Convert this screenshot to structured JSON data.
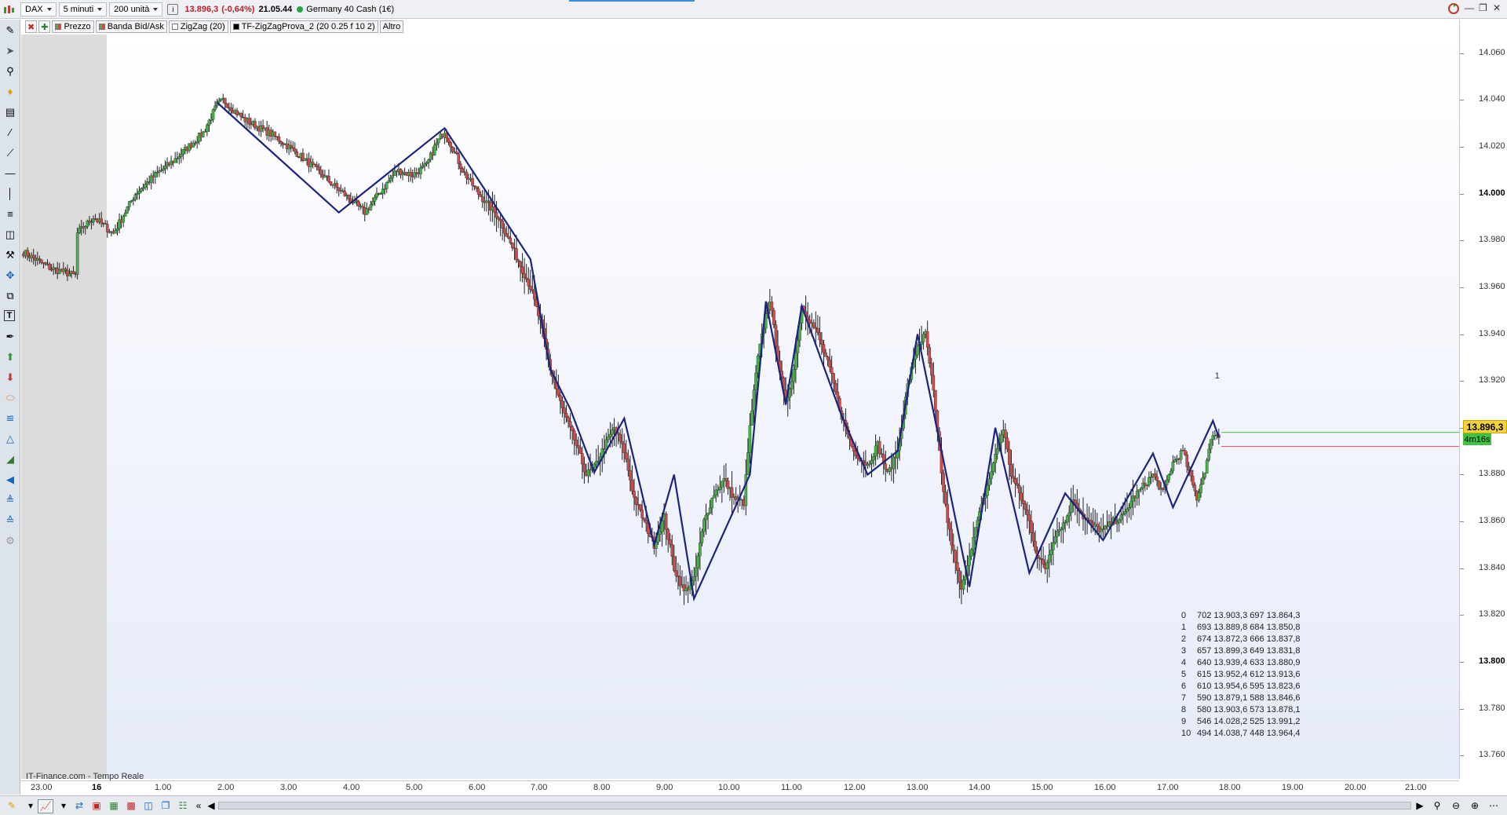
{
  "toolbar": {
    "symbol": "DAX",
    "timeframe": "5 minuti",
    "units": "200 unità",
    "info_icon": "info-icon",
    "last_price": "13.896,3",
    "change": "(-0,64%)",
    "time": "21.05.44",
    "instrument": "Germany 40 Cash (1€)"
  },
  "indicators": {
    "price": "Prezzo",
    "bidask": "Banda Bid/Ask",
    "zigzag": "ZigZag (20)",
    "tfzigzag": "TF-ZigZagProva_2 (20 0.25 f 10 2)",
    "more": "Altro"
  },
  "footer_note": "IT-Finance.com - Tempo Reale",
  "current_price_tag": "13.896,3",
  "timer_tag": "4m16s",
  "zz_marker": "1",
  "zigzag_table": [
    [
      "0",
      "702 13.903,3 697 13.864,3"
    ],
    [
      "1",
      "693 13.889,8 684 13.850,8"
    ],
    [
      "2",
      "674 13.872,3 666 13.837,8"
    ],
    [
      "3",
      "657 13.899,3 649 13.831,8"
    ],
    [
      "4",
      "640 13.939,4 633 13.880,9"
    ],
    [
      "5",
      "615 13.952,4 612 13.913,6"
    ],
    [
      "6",
      "610 13.954,6 595 13.823,6"
    ],
    [
      "7",
      "590 13.879,1 588 13.846,6"
    ],
    [
      "8",
      "580 13.903,6 573 13.878,1"
    ],
    [
      "9",
      "546 14.028,2 525 13.991,2"
    ],
    [
      "10",
      "494 14.038,7 448 13.964,4"
    ]
  ],
  "colors": {
    "bull": "#45b245",
    "bear": "#d24a4a",
    "zigzag": "#1a237e",
    "accent": "#3a8ee6"
  },
  "chart_data": {
    "type": "candlestick",
    "xlabels": [
      "23.00",
      "16",
      "1.00",
      "2.00",
      "3.00",
      "4.00",
      "5.00",
      "6.00",
      "7.00",
      "8.00",
      "9.00",
      "10.00",
      "11.00",
      "12.00",
      "13.00",
      "14.00",
      "15.00",
      "16.00",
      "17.00",
      "18.00",
      "19.00",
      "20.00",
      "21.00"
    ],
    "ylabels": [
      "14.060",
      "14.040",
      "14.020",
      "14.000",
      "13.980",
      "13.960",
      "13.940",
      "13.920",
      "13.900",
      "13.880",
      "13.860",
      "13.840",
      "13.820",
      "13.800",
      "13.780",
      "13.760"
    ],
    "ylim": [
      13750,
      14068
    ],
    "anchors": [
      [
        0,
        13975
      ],
      [
        14,
        13968
      ],
      [
        26,
        13965
      ],
      [
        27,
        13983
      ],
      [
        35,
        13990
      ],
      [
        45,
        13983
      ],
      [
        56,
        14000
      ],
      [
        66,
        14008
      ],
      [
        75,
        14014
      ],
      [
        85,
        14022
      ],
      [
        90,
        14026
      ],
      [
        97,
        14038
      ],
      [
        100,
        14040
      ],
      [
        110,
        14032
      ],
      [
        125,
        14025
      ],
      [
        139,
        14016
      ],
      [
        151,
        14007
      ],
      [
        163,
        13998
      ],
      [
        171,
        13992
      ],
      [
        179,
        14001
      ],
      [
        187,
        14010
      ],
      [
        195,
        14008
      ],
      [
        202,
        14012
      ],
      [
        206,
        14020
      ],
      [
        211,
        14027
      ],
      [
        220,
        14010
      ],
      [
        228,
        14000
      ],
      [
        238,
        13990
      ],
      [
        246,
        13975
      ],
      [
        254,
        13960
      ],
      [
        259,
        13945
      ],
      [
        264,
        13925
      ],
      [
        270,
        13908
      ],
      [
        276,
        13895
      ],
      [
        282,
        13880
      ],
      [
        286,
        13883
      ],
      [
        291,
        13892
      ],
      [
        296,
        13900
      ],
      [
        301,
        13890
      ],
      [
        306,
        13870
      ],
      [
        311,
        13860
      ],
      [
        316,
        13850
      ],
      [
        321,
        13862
      ],
      [
        326,
        13840
      ],
      [
        331,
        13830
      ],
      [
        336,
        13835
      ],
      [
        341,
        13860
      ],
      [
        346,
        13872
      ],
      [
        351,
        13878
      ],
      [
        356,
        13870
      ],
      [
        361,
        13868
      ],
      [
        364,
        13900
      ],
      [
        368,
        13930
      ],
      [
        372,
        13948
      ],
      [
        374,
        13955
      ],
      [
        378,
        13930
      ],
      [
        382,
        13910
      ],
      [
        386,
        13925
      ],
      [
        390,
        13952
      ],
      [
        398,
        13940
      ],
      [
        404,
        13925
      ],
      [
        410,
        13905
      ],
      [
        416,
        13890
      ],
      [
        423,
        13884
      ],
      [
        428,
        13893
      ],
      [
        433,
        13880
      ],
      [
        438,
        13890
      ],
      [
        443,
        13918
      ],
      [
        448,
        13935
      ],
      [
        452,
        13940
      ],
      [
        456,
        13915
      ],
      [
        460,
        13880
      ],
      [
        463,
        13860
      ],
      [
        467,
        13842
      ],
      [
        470,
        13830
      ],
      [
        474,
        13846
      ],
      [
        478,
        13860
      ],
      [
        482,
        13872
      ],
      [
        487,
        13888
      ],
      [
        491,
        13900
      ],
      [
        495,
        13880
      ],
      [
        499,
        13872
      ],
      [
        504,
        13860
      ],
      [
        508,
        13845
      ],
      [
        512,
        13840
      ],
      [
        517,
        13855
      ],
      [
        522,
        13860
      ],
      [
        526,
        13870
      ],
      [
        531,
        13862
      ],
      [
        536,
        13858
      ],
      [
        541,
        13856
      ],
      [
        546,
        13860
      ],
      [
        551,
        13862
      ],
      [
        556,
        13870
      ],
      [
        561,
        13875
      ],
      [
        566,
        13880
      ],
      [
        571,
        13872
      ],
      [
        576,
        13885
      ],
      [
        581,
        13890
      ],
      [
        585,
        13878
      ],
      [
        588,
        13870
      ],
      [
        592,
        13882
      ],
      [
        596,
        13898
      ],
      [
        599,
        13896
      ]
    ],
    "zigzag": [
      [
        97,
        14039
      ],
      [
        158,
        13992
      ],
      [
        211,
        14028
      ],
      [
        254,
        13972
      ],
      [
        264,
        13925
      ],
      [
        274,
        13908
      ],
      [
        286,
        13881
      ],
      [
        301,
        13904
      ],
      [
        316,
        13850
      ],
      [
        326,
        13880
      ],
      [
        336,
        13827
      ],
      [
        364,
        13880
      ],
      [
        372,
        13954
      ],
      [
        382,
        13910
      ],
      [
        390,
        13952
      ],
      [
        410,
        13905
      ],
      [
        423,
        13880
      ],
      [
        438,
        13890
      ],
      [
        448,
        13940
      ],
      [
        474,
        13832
      ],
      [
        487,
        13900
      ],
      [
        504,
        13838
      ],
      [
        522,
        13872
      ],
      [
        541,
        13852
      ],
      [
        566,
        13889
      ],
      [
        576,
        13866
      ],
      [
        596,
        13903
      ],
      [
        599,
        13896
      ]
    ]
  }
}
